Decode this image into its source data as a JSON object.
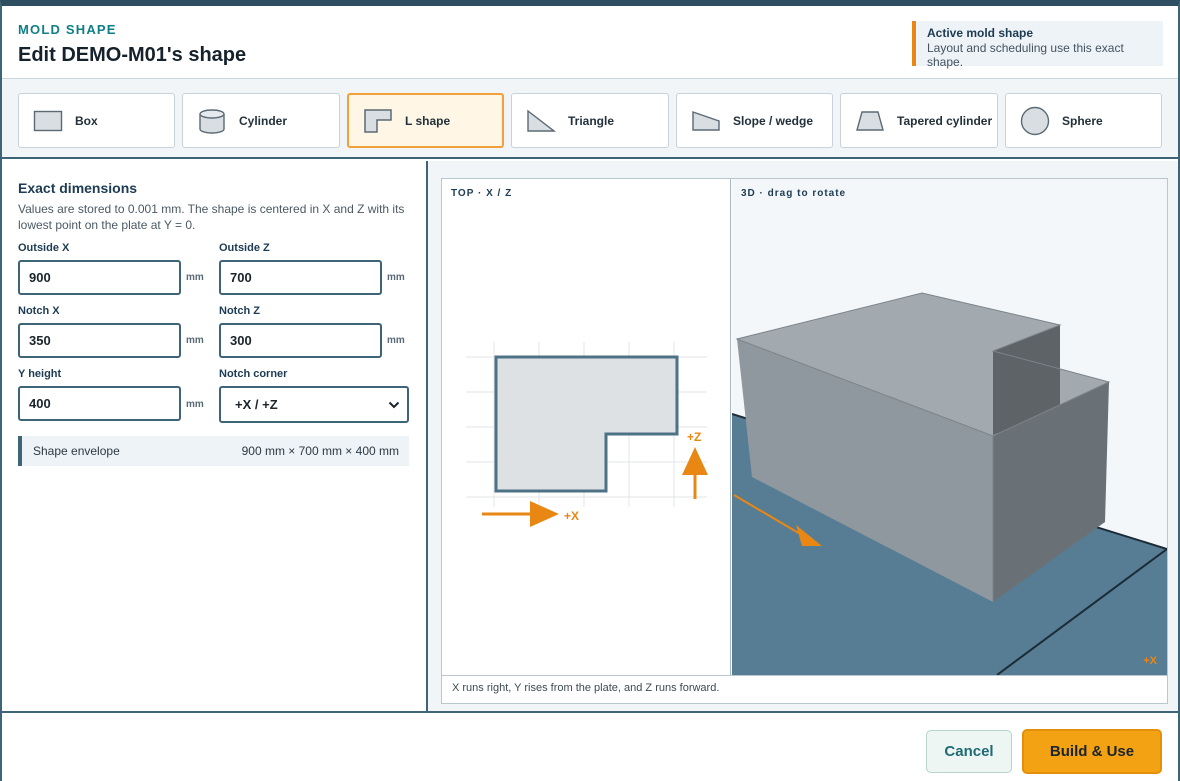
{
  "header": {
    "eyebrow": "MOLD SHAPE",
    "title": "Edit DEMO-M01's shape",
    "active_title": "Active mold shape",
    "active_sub": "Layout and scheduling use this exact shape."
  },
  "shapes": [
    {
      "label": "Box",
      "icon": "box-icon"
    },
    {
      "label": "Cylinder",
      "icon": "cylinder-icon"
    },
    {
      "label": "L shape",
      "icon": "l-shape-icon",
      "selected": true
    },
    {
      "label": "Triangle",
      "icon": "triangle-icon"
    },
    {
      "label": "Slope / wedge",
      "icon": "wedge-icon"
    },
    {
      "label": "Tapered cylinder",
      "icon": "tapered-cylinder-icon"
    },
    {
      "label": "Sphere",
      "icon": "sphere-icon"
    }
  ],
  "dimensions": {
    "title": "Exact dimensions",
    "description": "Values are stored to 0.001 mm. The shape is centered in X and Z with its lowest point on the plate at Y = 0.",
    "outside_x": {
      "label": "Outside X",
      "value": "900",
      "unit": "mm"
    },
    "outside_z": {
      "label": "Outside Z",
      "value": "700",
      "unit": "mm"
    },
    "notch_x": {
      "label": "Notch X",
      "value": "350",
      "unit": "mm"
    },
    "notch_z": {
      "label": "Notch Z",
      "value": "300",
      "unit": "mm"
    },
    "y_height": {
      "label": "Y height",
      "value": "400",
      "unit": "mm"
    },
    "notch_corner": {
      "label": "Notch corner",
      "value": "+X / +Z"
    },
    "envelope_label": "Shape envelope",
    "envelope_value": "900 mm × 700 mm × 400 mm"
  },
  "viewer": {
    "top_label": "TOP · X / Z",
    "view3d_label": "3D · drag to rotate",
    "axis_x": "+X",
    "axis_z": "+Z",
    "caption": "X runs right, Y rises from the plate, and Z runs forward."
  },
  "footer": {
    "cancel_label": "Cancel",
    "build_label": "Build & Use"
  },
  "colors": {
    "accent": "#e98714",
    "teal": "#0f7f86",
    "frame": "#3e6478",
    "plate": "#577d95",
    "solid": "#8f9aa3"
  }
}
